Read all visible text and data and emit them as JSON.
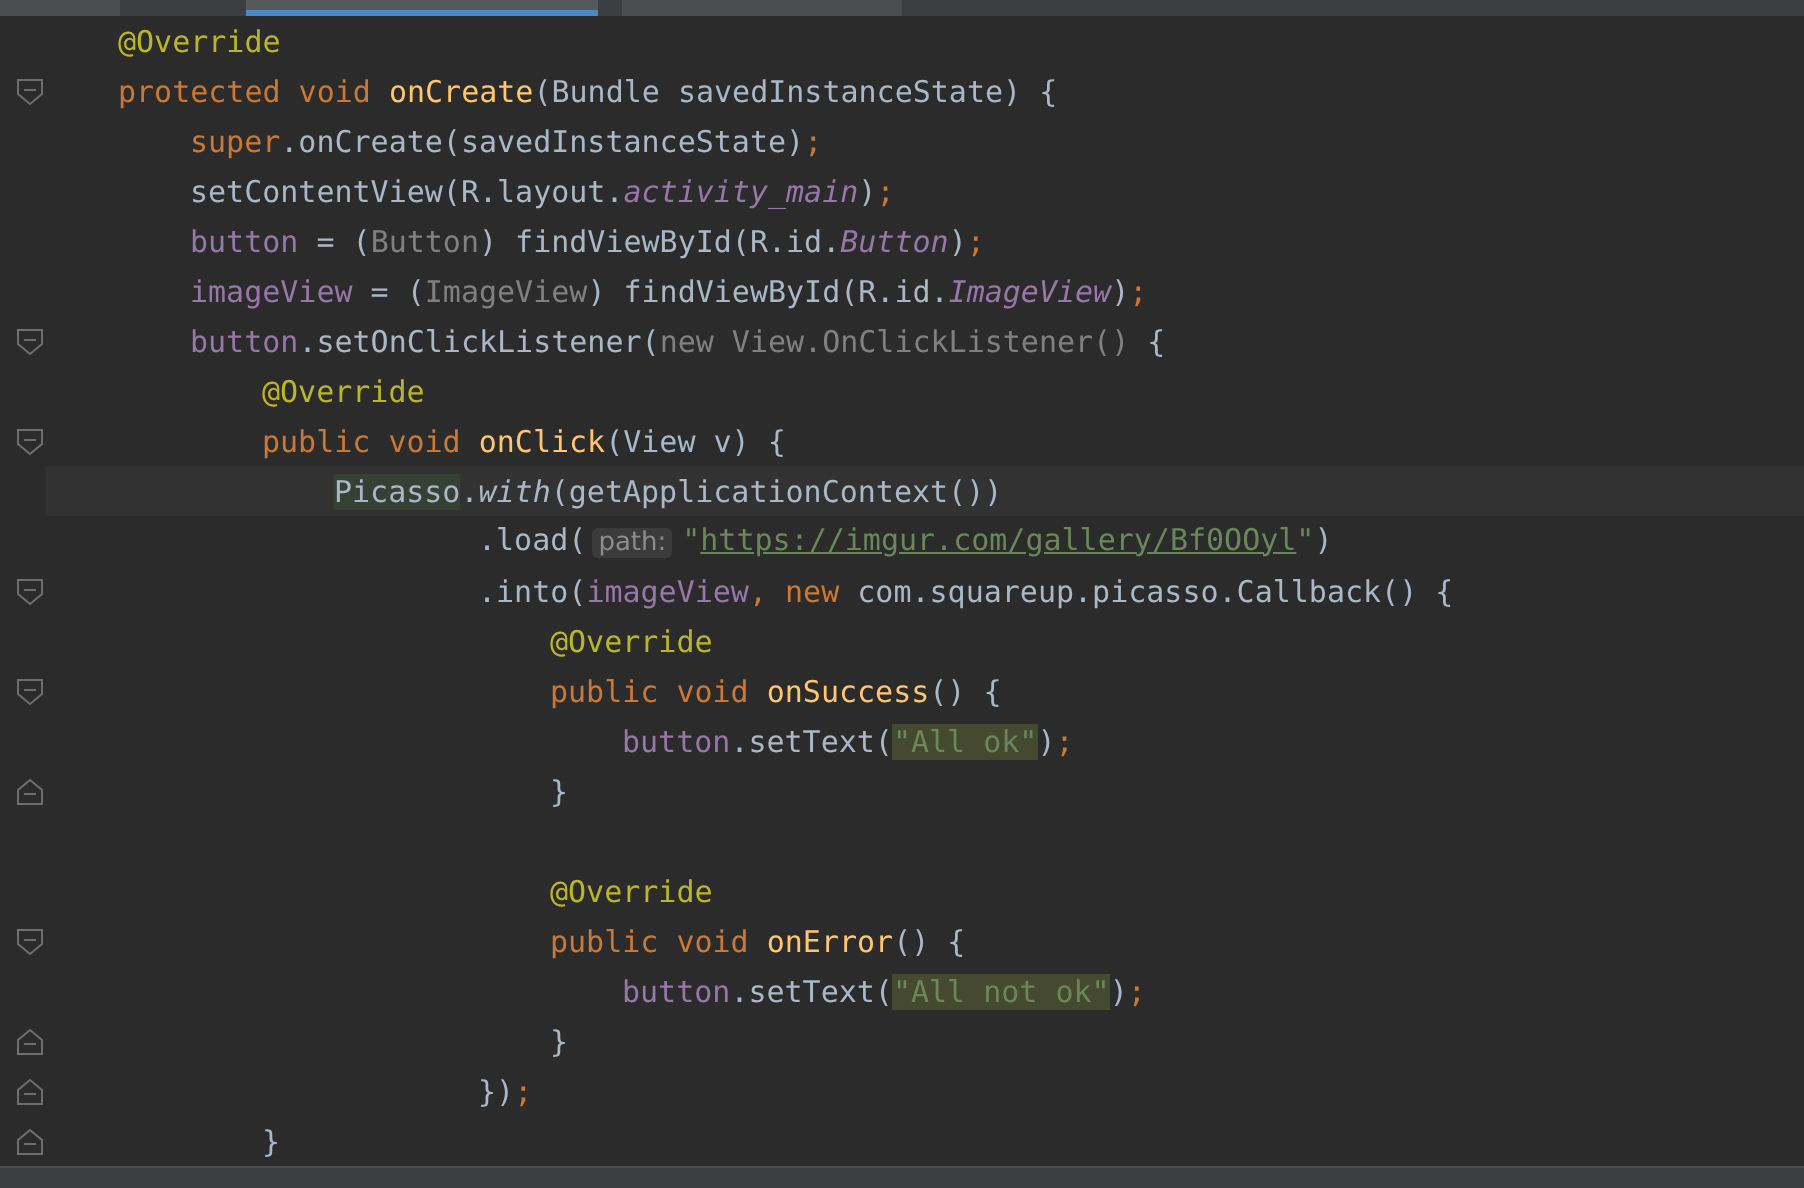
{
  "tabs": [
    {
      "selected": false
    },
    {
      "selected": true
    },
    {
      "selected": false
    }
  ],
  "editor": {
    "lines": [
      {
        "current": false,
        "tokens": [
          {
            "kind": "ann",
            "text": "@Override"
          }
        ]
      },
      {
        "current": false,
        "fold": {
          "kind": "start"
        },
        "tokens": [
          {
            "kind": "kw",
            "text": "protected void "
          },
          {
            "kind": "decl",
            "text": "onCreate"
          },
          {
            "kind": "plain",
            "text": "(Bundle savedInstanceState) {"
          }
        ],
        "children": [
          {
            "current": false,
            "tokens": [
              {
                "kind": "kw",
                "text": "super"
              },
              {
                "kind": "plain",
                "text": ".onCreate(savedInstanceState)"
              },
              {
                "kind": "kw",
                "text": ";"
              }
            ]
          },
          {
            "current": false,
            "tokens": [
              {
                "kind": "plain",
                "text": "setContentView(R.layout."
              },
              {
                "kind": "fieldi",
                "text": "activity_main"
              },
              {
                "kind": "plain",
                "text": ")"
              },
              {
                "kind": "kw",
                "text": ";"
              }
            ]
          },
          {
            "current": false,
            "tokens": [
              {
                "kind": "field",
                "text": "button"
              },
              {
                "kind": "plain",
                "text": " = ("
              },
              {
                "kind": "dim",
                "text": "Button"
              },
              {
                "kind": "plain",
                "text": ") findViewById(R.id."
              },
              {
                "kind": "fieldi",
                "text": "Button"
              },
              {
                "kind": "plain",
                "text": ")"
              },
              {
                "kind": "kw",
                "text": ";"
              }
            ]
          },
          {
            "current": false,
            "tokens": [
              {
                "kind": "field",
                "text": "imageView"
              },
              {
                "kind": "plain",
                "text": " = ("
              },
              {
                "kind": "dim",
                "text": "ImageView"
              },
              {
                "kind": "plain",
                "text": ") findViewById(R.id."
              },
              {
                "kind": "fieldi",
                "text": "ImageView"
              },
              {
                "kind": "plain",
                "text": ")"
              },
              {
                "kind": "kw",
                "text": ";"
              }
            ]
          },
          {
            "current": false,
            "fold": {
              "kind": "start"
            },
            "tokens": [
              {
                "kind": "field",
                "text": "button"
              },
              {
                "kind": "plain",
                "text": ".setOnClickListener("
              },
              {
                "kind": "dim",
                "text": "new View.OnClickListener()"
              },
              {
                "kind": "plain",
                "text": " {"
              }
            ],
            "children": [
              {
                "current": false,
                "tokens": [
                  {
                    "kind": "ann",
                    "text": "@Override"
                  }
                ]
              },
              {
                "current": false,
                "fold": {
                  "kind": "start"
                },
                "tokens": [
                  {
                    "kind": "kw",
                    "text": "public void "
                  },
                  {
                    "kind": "decl",
                    "text": "onClick"
                  },
                  {
                    "kind": "plain",
                    "text": "(View v) {"
                  }
                ],
                "children": [
                  {
                    "current": true,
                    "kind": "chain",
                    "tokens": [
                      {
                        "kind": "hlclass",
                        "text": "Picasso"
                      },
                      {
                        "kind": "plain",
                        "text": "."
                      },
                      {
                        "kind": "methodi",
                        "text": "with"
                      },
                      {
                        "kind": "plain",
                        "text": "(getApplicationContext())"
                      }
                    ],
                    "children": [
                      {
                        "current": false,
                        "tokens": [
                          {
                            "kind": "plain",
                            "text": ".load("
                          },
                          {
                            "kind": "hint",
                            "text": "path:"
                          },
                          {
                            "kind": "str",
                            "text": "\""
                          },
                          {
                            "kind": "url",
                            "text": "https://imgur.com/gallery/Bf0OOyl"
                          },
                          {
                            "kind": "str",
                            "text": "\""
                          },
                          {
                            "kind": "plain",
                            "text": ")"
                          }
                        ]
                      },
                      {
                        "current": false,
                        "fold": {
                          "kind": "start"
                        },
                        "tokens": [
                          {
                            "kind": "plain",
                            "text": ".into("
                          },
                          {
                            "kind": "field",
                            "text": "imageView"
                          },
                          {
                            "kind": "kw",
                            "text": ", new "
                          },
                          {
                            "kind": "plain",
                            "text": "com.squareup.picasso.Callback() {"
                          }
                        ],
                        "children": [
                          {
                            "current": false,
                            "tokens": [
                              {
                                "kind": "ann",
                                "text": "@Override"
                              }
                            ]
                          },
                          {
                            "current": false,
                            "fold": {
                              "kind": "start"
                            },
                            "tokens": [
                              {
                                "kind": "kw",
                                "text": "public void "
                              },
                              {
                                "kind": "decl",
                                "text": "onSuccess"
                              },
                              {
                                "kind": "plain",
                                "text": "() {"
                              }
                            ],
                            "children": [
                              {
                                "current": false,
                                "tokens": [
                                  {
                                    "kind": "field",
                                    "text": "button"
                                  },
                                  {
                                    "kind": "plain",
                                    "text": ".setText("
                                  },
                                  {
                                    "kind": "strhl",
                                    "text": "\"All ok\""
                                  },
                                  {
                                    "kind": "plain",
                                    "text": ")"
                                  },
                                  {
                                    "kind": "kw",
                                    "text": ";"
                                  }
                                ]
                              }
                            ]
                          },
                          {
                            "current": false,
                            "fold": {
                              "kind": "end"
                            },
                            "tokens": [
                              {
                                "kind": "plain",
                                "text": "}"
                              }
                            ]
                          },
                          {
                            "kind": "blank"
                          },
                          {
                            "current": false,
                            "tokens": [
                              {
                                "kind": "ann",
                                "text": "@Override"
                              }
                            ]
                          },
                          {
                            "current": false,
                            "fold": {
                              "kind": "start"
                            },
                            "tokens": [
                              {
                                "kind": "kw",
                                "text": "public void "
                              },
                              {
                                "kind": "decl",
                                "text": "onError"
                              },
                              {
                                "kind": "plain",
                                "text": "() {"
                              }
                            ],
                            "children": [
                              {
                                "current": false,
                                "tokens": [
                                  {
                                    "kind": "field",
                                    "text": "button"
                                  },
                                  {
                                    "kind": "plain",
                                    "text": ".setText("
                                  },
                                  {
                                    "kind": "strhl",
                                    "text": "\"All not ok\""
                                  },
                                  {
                                    "kind": "plain",
                                    "text": ")"
                                  },
                                  {
                                    "kind": "kw",
                                    "text": ";"
                                  }
                                ]
                              }
                            ]
                          },
                          {
                            "current": false,
                            "fold": {
                              "kind": "end"
                            },
                            "tokens": [
                              {
                                "kind": "plain",
                                "text": "}"
                              }
                            ]
                          }
                        ]
                      },
                      {
                        "current": false,
                        "fold": {
                          "kind": "end"
                        },
                        "tokens": [
                          {
                            "kind": "plain",
                            "text": "})"
                          },
                          {
                            "kind": "kw",
                            "text": ";"
                          }
                        ]
                      }
                    ]
                  }
                ]
              },
              {
                "current": false,
                "fold": {
                  "kind": "end"
                },
                "tokens": [
                  {
                    "kind": "plain",
                    "text": "}"
                  }
                ]
              }
            ]
          }
        ]
      }
    ]
  }
}
